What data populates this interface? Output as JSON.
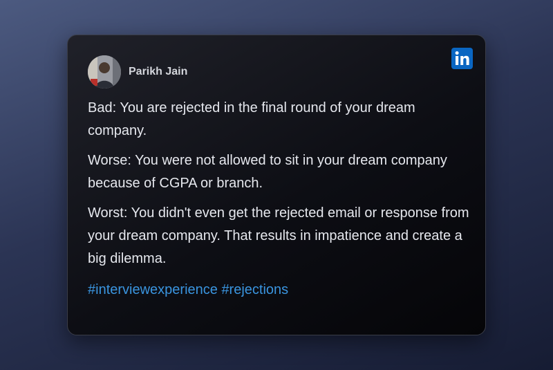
{
  "post": {
    "author_name": "Parikh Jain",
    "avatar_icon": "profile-photo",
    "network_icon": "linkedin-icon",
    "paragraphs": [
      "Bad: You are rejected in the final round of your dream company.",
      "Worse: You were not allowed to sit in your dream company because of CGPA or branch.",
      "Worst: You didn't even get the rejected email or response from your dream company. That results in impatience and create a big dilemma."
    ],
    "hashtags": "#interviewexperience #rejections"
  },
  "colors": {
    "linkedin_blue": "#0a66c2",
    "hashtag_blue": "#3a95e0"
  }
}
